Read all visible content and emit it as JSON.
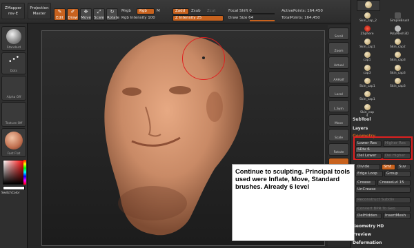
{
  "top": {
    "zmapper": "ZMapper",
    "zmapper_sub": "rev-E",
    "projection_line1": "Projection",
    "projection_line2": "Master",
    "tools": [
      {
        "label": "Edit",
        "active": true
      },
      {
        "label": "Draw",
        "active": true
      },
      {
        "label": "Move",
        "active": false
      },
      {
        "label": "Scale",
        "active": false
      },
      {
        "label": "Rotate",
        "active": false
      }
    ],
    "mrgb": "Mrgb",
    "rgb": "Rgb",
    "m": "M",
    "zadd": "Zadd",
    "zsub": "Zsub",
    "zcut": "Zcut",
    "rgb_intensity": "Rgb Intensity 100",
    "z_intensity": "Z Intensity 25",
    "focal_shift": "Focal Shift 0",
    "draw_size": "Draw Size 64",
    "active_points": "ActivePoints: 164,450",
    "total_points": "TotalPoints: 164,450"
  },
  "left": {
    "thumbs": [
      "Standard",
      "Dots",
      "Alpha Off",
      "Texture Off",
      "Fast Flat"
    ],
    "switch_color": "SwitchColor"
  },
  "right_tools": [
    "Scroll",
    "Zoom",
    "Actual",
    "AAHalf",
    "Local",
    "L.Sym",
    "Move",
    "Scale",
    "Rotate",
    "PolyF",
    ""
  ],
  "tool_palette": {
    "items": [
      [
        "Skin_cap_2",
        "SimpleBrush"
      ],
      [
        "ZSphere",
        "PolyMesh3D"
      ],
      [
        "Skin_cap1",
        "Skin_cap2"
      ],
      [
        "cap1",
        "Skin_cap3"
      ],
      [
        "cap3",
        "Skin_cap3"
      ],
      [
        "Skin_cap1",
        "Skin_cap3"
      ],
      [
        "Skin_cap1",
        ""
      ],
      [
        "Skin_cap 4",
        ""
      ]
    ]
  },
  "subtool": {
    "subtool_label": "SubTool",
    "layers_label": "Layers",
    "geometry_label": "Geometry",
    "lower_res": "Lower Res",
    "higher_res": "Higher Res",
    "sdiv": "SDiv 6",
    "del_lower": "Del Lower",
    "del_higher": "Del Higher",
    "divide": "Divide",
    "smt": "Smt",
    "suv": "Suv",
    "edge_loop": "Edge Loop",
    "group": "Group",
    "crease": "Crease",
    "crease_lvl": "CreaseLvl 15",
    "uncrease": "UnCrease",
    "reconstruct": "Reconstruct Subdiv",
    "convert": "Convert BPR To Geo",
    "delhidden": "DelHidden",
    "insertmesh": "InsertMesh",
    "geometry_hd": "Geometry HD",
    "preview": "Preview",
    "deformation": "Deformation"
  },
  "note": "Continue to sculpting. Principal tools used were Inflate, Move, Standard brushes. Already 6 level",
  "colors": {
    "accent": "#c8621e",
    "skin": "#c98a66",
    "highlight_red": "#e02020"
  }
}
